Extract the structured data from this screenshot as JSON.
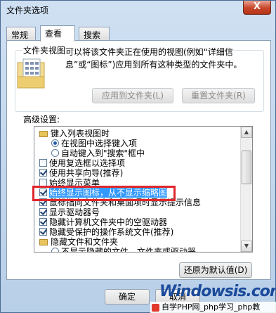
{
  "window": {
    "title": "文件夹选项",
    "close_glyph": "X"
  },
  "tabs": [
    {
      "label": "常规",
      "active": false
    },
    {
      "label": "查看",
      "active": true
    },
    {
      "label": "搜索",
      "active": false
    }
  ],
  "folder_views": {
    "legend": "文件夹视图",
    "description_line1": "可以将该文件夹正在使用的视图(例如“详细信",
    "description_line2": "息”或“图标”)应用到所有这种类型的文件夹中。",
    "apply_button": "应用到文件夹(L)",
    "reset_button": "重置文件夹(R)"
  },
  "advanced": {
    "legend": "高级设置:",
    "items": [
      {
        "type": "folder",
        "label": "键入列表视图时"
      },
      {
        "type": "radio",
        "checked": true,
        "label": "在视图中选择键入项"
      },
      {
        "type": "radio",
        "checked": false,
        "label": "自动键入到\"搜索\"框中"
      },
      {
        "type": "checkbox",
        "checked": false,
        "label": "使用复选框以选择项"
      },
      {
        "type": "checkbox",
        "checked": true,
        "label": "使用共享向导(推荐)"
      },
      {
        "type": "checkbox",
        "checked": false,
        "label": "始终显示菜单"
      },
      {
        "type": "checkbox",
        "checked": true,
        "label": "始终显示图标，从不显示缩略图",
        "selected": true
      },
      {
        "type": "checkbox",
        "checked": true,
        "label": "鼠标指向文件夹和桌面项时显示提示信息"
      },
      {
        "type": "checkbox",
        "checked": true,
        "label": "显示驱动器号"
      },
      {
        "type": "checkbox",
        "checked": true,
        "label": "隐藏计算机文件夹中的空驱动器"
      },
      {
        "type": "checkbox",
        "checked": true,
        "label": "隐藏受保护的操作系统文件(推荐)"
      },
      {
        "type": "folder",
        "label": "隐藏文件和文件夹"
      },
      {
        "type": "radio",
        "checked": false,
        "label": "不显示隐藏的文件、文件夹或驱动器"
      }
    ],
    "restore_button": "还原为默认值(D)"
  },
  "footer": {
    "ok_button": "确定",
    "cancel_button": "取消"
  },
  "watermark": {
    "site": "Windowsis.com",
    "caption": "自学PHP网_php学习_php教"
  },
  "colors": {
    "highlight": "#e0262b",
    "selection": "#3399ff"
  }
}
